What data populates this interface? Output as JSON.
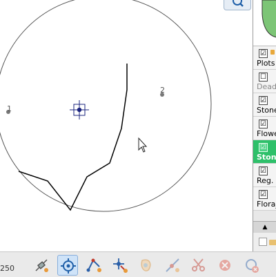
{
  "map": {
    "points": [
      {
        "label": "1"
      },
      {
        "label": "2"
      }
    ]
  },
  "layers": [
    {
      "name": "Plots",
      "checked": "☑",
      "locked": true
    },
    {
      "name": "Dead",
      "checked": "☐"
    },
    {
      "name": "Stone",
      "checked": "☑"
    },
    {
      "name": "Flowe",
      "checked": "☑"
    },
    {
      "name": "Stone",
      "checked": "☑",
      "active": true
    },
    {
      "name": "Reg. ",
      "checked": "☑"
    },
    {
      "name": "Flora_",
      "checked": "☑"
    }
  ],
  "layer_scroll_up_glyph": "▲",
  "toolbar": {
    "scale_text": "250",
    "tools": [
      {
        "name": "satellite-icon"
      },
      {
        "name": "gps-target-icon",
        "active": true
      },
      {
        "name": "add-vertex-icon"
      },
      {
        "name": "move-vertex-icon"
      },
      {
        "name": "shape-edit-icon",
        "disabled": true
      },
      {
        "name": "split-line-icon",
        "disabled": true
      },
      {
        "name": "scissors-icon",
        "disabled": true
      },
      {
        "name": "delete-feature-icon",
        "disabled": true
      },
      {
        "name": "delete-vertex-icon",
        "disabled": true
      }
    ]
  },
  "colors": {
    "active_layer": "#2ec06a",
    "gps_marker": "#1a237e",
    "toolbar_active": "#cfe3f8"
  }
}
